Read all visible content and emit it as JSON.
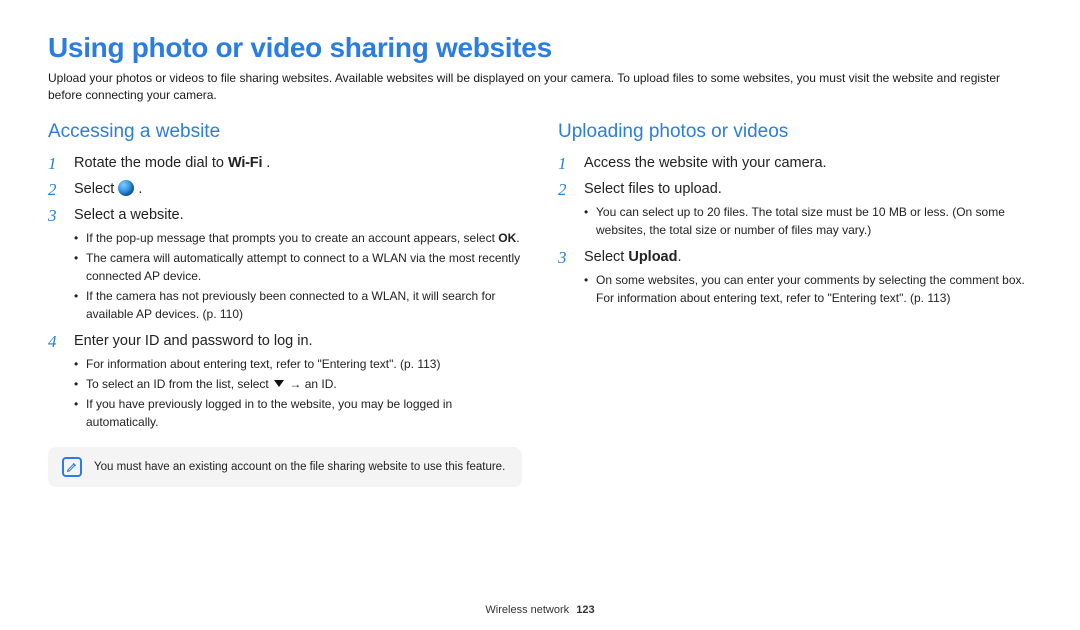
{
  "title": "Using photo or video sharing websites",
  "intro": "Upload your photos or videos to file sharing websites. Available websites will be displayed on your camera. To upload files to some websites, you must visit the website and register before connecting your camera.",
  "left": {
    "heading": "Accessing a website",
    "step1a": "Rotate the mode dial to ",
    "step1_wifi": "Wi-Fi",
    "step1b": " .",
    "step2": "Select ",
    "step2b": " .",
    "step3": "Select a website.",
    "step3_bullets": {
      "b1a": "If the pop-up message that prompts you to create an account appears, select ",
      "b1_ok": "OK",
      "b1b": ".",
      "b2": "The camera will automatically attempt to connect to a WLAN via the most recently connected AP device.",
      "b3": "If the camera has not previously been connected to a WLAN, it will search for available AP devices. (p. 110)"
    },
    "step4": "Enter your ID and password to log in.",
    "step4_bullets": {
      "b1": "For information about entering text, refer to \"Entering text\". (p. 113)",
      "b2a": "To select an ID from the list, select ",
      "b2b": " → an ID.",
      "b3": "If you have previously logged in to the website, you may be logged in automatically."
    },
    "note": "You must have an existing account on the file sharing website to use this feature."
  },
  "right": {
    "heading": "Uploading photos or videos",
    "step1": "Access the website with your camera.",
    "step2": "Select files to upload.",
    "step2_bullets": {
      "b1": "You can select up to 20 files. The total size must be 10 MB or less. (On some websites, the total size or number of files may vary.)"
    },
    "step3a": "Select ",
    "step3_upload": "Upload",
    "step3b": ".",
    "step3_bullets": {
      "b1": "On some websites, you can enter your comments by selecting the comment box. For information about entering text, refer to \"Entering text\". (p. 113)"
    }
  },
  "footer_label": "Wireless network",
  "footer_page": "123"
}
